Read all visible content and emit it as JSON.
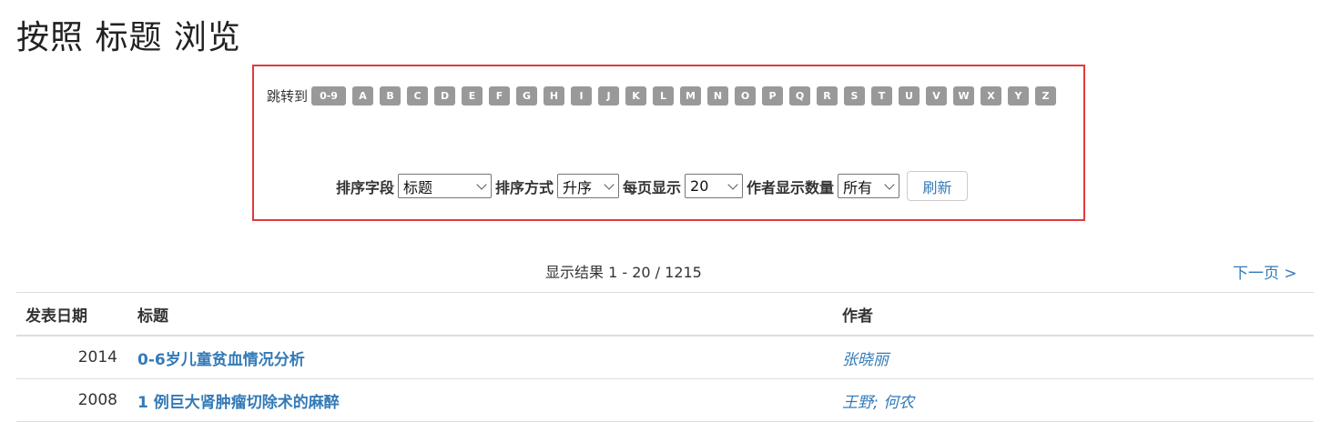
{
  "page": {
    "title": "按照 标题 浏览"
  },
  "jump": {
    "label": "跳转到",
    "letters": [
      "0-9",
      "A",
      "B",
      "C",
      "D",
      "E",
      "F",
      "G",
      "H",
      "I",
      "J",
      "K",
      "L",
      "M",
      "N",
      "O",
      "P",
      "Q",
      "R",
      "S",
      "T",
      "U",
      "V",
      "W",
      "X",
      "Y",
      "Z"
    ]
  },
  "sort": {
    "field_label": "排序字段",
    "field_value": "标题",
    "order_label": "排序方式",
    "order_value": "升序",
    "per_page_label": "每页显示",
    "per_page_value": "20",
    "author_count_label": "作者显示数量",
    "author_count_value": "所有",
    "refresh_label": "刷新"
  },
  "results": {
    "info": "显示结果 1 - 20 / 1215",
    "next_label": "下一页 >"
  },
  "table": {
    "headers": {
      "date": "发表日期",
      "title": "标题",
      "authors": "作者"
    },
    "rows": [
      {
        "date": "2014",
        "title": "0-6岁儿童贫血情况分析",
        "authors": "张晓丽"
      },
      {
        "date": "2008",
        "title": "1 例巨大肾肿瘤切除术的麻醉",
        "authors": "王野; 何农"
      }
    ]
  }
}
